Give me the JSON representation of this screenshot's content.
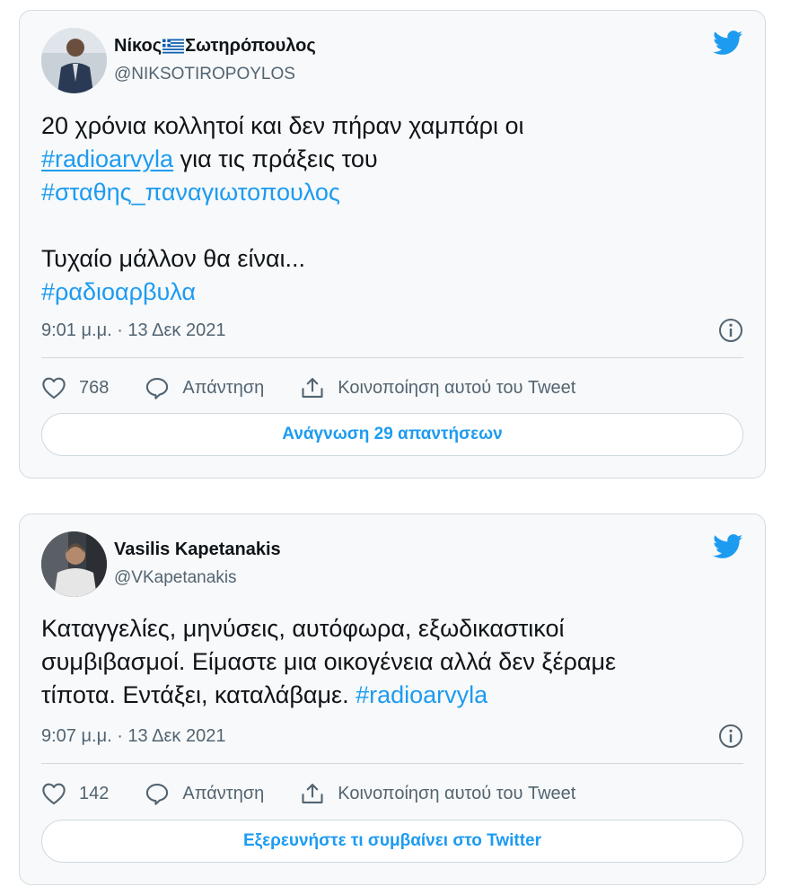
{
  "tweets": [
    {
      "author": {
        "name_part1": "Νίκος",
        "name_part2": "Σωτηρόπουλος",
        "handle": "@NIKSOTIROPOYLOS"
      },
      "text": {
        "line1": "20 χρόνια κολλητοί και δεν πήραν χαμπάρι οι",
        "hashtag1": "#radioarvyla",
        "line2_rest": " για τις πράξεις του",
        "hashtag2": "#σταθης_παναγιωτοπουλος",
        "line4": "Τυχαίο μάλλον θα είναι...",
        "hashtag3": "#ραδιοαρβυλα"
      },
      "timestamp": "9:01 μ.μ. · 13 Δεκ 2021",
      "likes": "768",
      "reply_label": "Απάντηση",
      "share_label": "Κοινοποίηση αυτού του Tweet",
      "cta_label": "Ανάγνωση 29 απαντήσεων"
    },
    {
      "author": {
        "name": "Vasilis Kapetanakis",
        "handle": "@VKapetanakis"
      },
      "text": {
        "line1": "Καταγγελίες, μηνύσεις, αυτόφωρα, εξωδικαστικοί",
        "line2": "συμβιβασμοί. Είμαστε μια οικογένεια αλλά δεν ξέραμε",
        "line3_start": "τίποτα. Εντάξει, καταλάβαμε. ",
        "hashtag": "#radioarvyla"
      },
      "timestamp": "9:07 μ.μ. · 13 Δεκ 2021",
      "likes": "142",
      "reply_label": "Απάντηση",
      "share_label": "Κοινοποίηση αυτού του Tweet",
      "cta_label": "Εξερευνήστε τι συμβαίνει στο Twitter"
    }
  ],
  "colors": {
    "accent": "#1d9bf0",
    "text": "#0f1419",
    "secondary": "#536471",
    "card_bg": "#f7f9fa"
  },
  "icons": [
    "twitter-bird-icon",
    "info-icon",
    "heart-icon",
    "reply-icon",
    "share-icon",
    "greek-flag-icon"
  ]
}
